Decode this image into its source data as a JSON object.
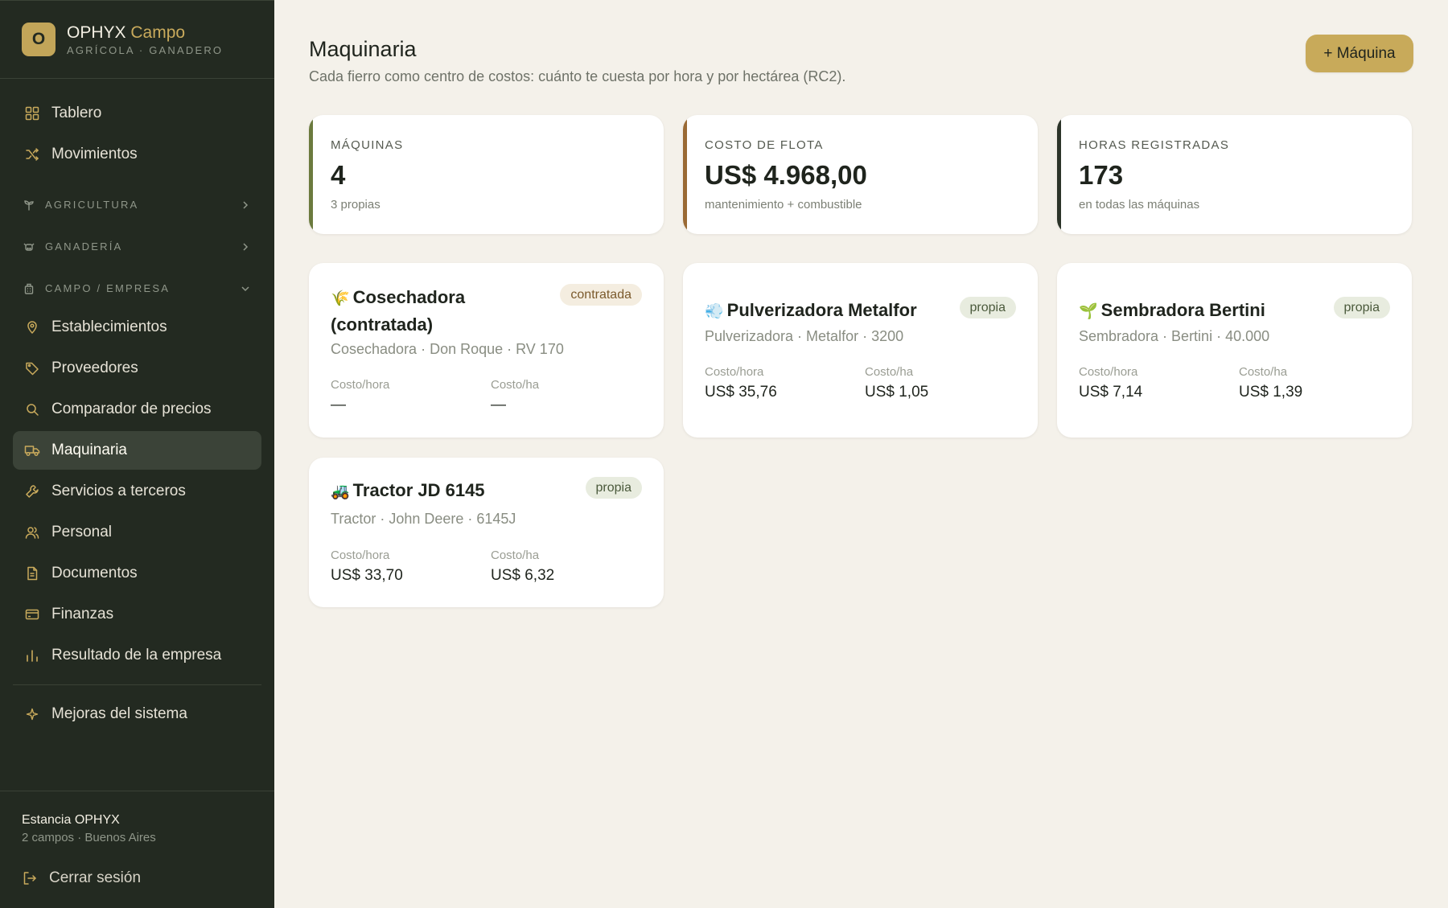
{
  "brand": {
    "logo_letter": "O",
    "name_main": "OPHYX",
    "name_accent": "Campo",
    "subtitle": "AGRÍCOLA · GANADERO"
  },
  "nav": {
    "tablero": "Tablero",
    "movimientos": "Movimientos",
    "section_agricultura": "AGRICULTURA",
    "section_ganaderia": "GANADERÍA",
    "section_campo": "CAMPO / EMPRESA",
    "establecimientos": "Establecimientos",
    "proveedores": "Proveedores",
    "comparador": "Comparador de precios",
    "maquinaria": "Maquinaria",
    "servicios": "Servicios a terceros",
    "personal": "Personal",
    "documentos": "Documentos",
    "finanzas": "Finanzas",
    "resultado": "Resultado de la empresa",
    "mejoras": "Mejoras del sistema"
  },
  "footer": {
    "org_name": "Estancia OPHYX",
    "org_sub": "2 campos · Buenos Aires",
    "logout": "Cerrar sesión"
  },
  "page": {
    "title": "Maquinaria",
    "subtitle": "Cada fierro como centro de costos: cuánto te cuesta por hora y por hectárea (RC2).",
    "add_button": "+ Máquina"
  },
  "stats": [
    {
      "label": "MÁQUINAS",
      "value": "4",
      "sub": "3 propias"
    },
    {
      "label": "COSTO DE FLOTA",
      "value": "US$ 4.968,00",
      "sub": "mantenimiento + combustible"
    },
    {
      "label": "HORAS REGISTRADAS",
      "value": "173",
      "sub": "en todas las máquinas"
    }
  ],
  "machines": [
    {
      "emoji": "🌾",
      "name_line1": "Cosechadora",
      "name_line2": "(contratada)",
      "badge": "contratada",
      "desc": "Cosechadora · Don Roque · RV 170",
      "cost_hour_label": "Costo/hora",
      "cost_hour": "—",
      "cost_ha_label": "Costo/ha",
      "cost_ha": "—"
    },
    {
      "emoji": "💨",
      "name": "Pulverizadora Metalfor",
      "badge": "propia",
      "desc": "Pulverizadora · Metalfor · 3200",
      "cost_hour_label": "Costo/hora",
      "cost_hour": "US$ 35,76",
      "cost_ha_label": "Costo/ha",
      "cost_ha": "US$ 1,05"
    },
    {
      "emoji": "🌱",
      "name": "Sembradora Bertini",
      "badge": "propia",
      "desc": "Sembradora · Bertini · 40.000",
      "cost_hour_label": "Costo/hora",
      "cost_hour": "US$ 7,14",
      "cost_ha_label": "Costo/ha",
      "cost_ha": "US$ 1,39"
    },
    {
      "emoji": "🚜",
      "name": "Tractor JD 6145",
      "badge": "propia",
      "desc": "Tractor · John Deere · 6145J",
      "cost_hour_label": "Costo/hora",
      "cost_hour": "US$ 33,70",
      "cost_ha_label": "Costo/ha",
      "cost_ha": "US$ 6,32"
    }
  ],
  "colors": {
    "sidebar_bg": "#232a21",
    "accent_gold": "#c8aa5a",
    "bar_olive": "#6b7a3e",
    "bar_brown": "#9a6a35",
    "bar_dark": "#2c3429"
  },
  "icons": {
    "tablero": "grid-icon",
    "movimientos": "shuffle-icon",
    "agricultura": "sprout-icon",
    "ganaderia": "cow-icon",
    "campo": "building-icon",
    "establecimientos": "map-pin-icon",
    "proveedores": "tag-icon",
    "comparador": "search-icon",
    "maquinaria": "truck-icon",
    "servicios": "wrench-icon",
    "personal": "users-icon",
    "documentos": "document-icon",
    "finanzas": "credit-card-icon",
    "resultado": "bar-chart-icon",
    "mejoras": "sparkle-icon",
    "logout": "logout-icon"
  }
}
